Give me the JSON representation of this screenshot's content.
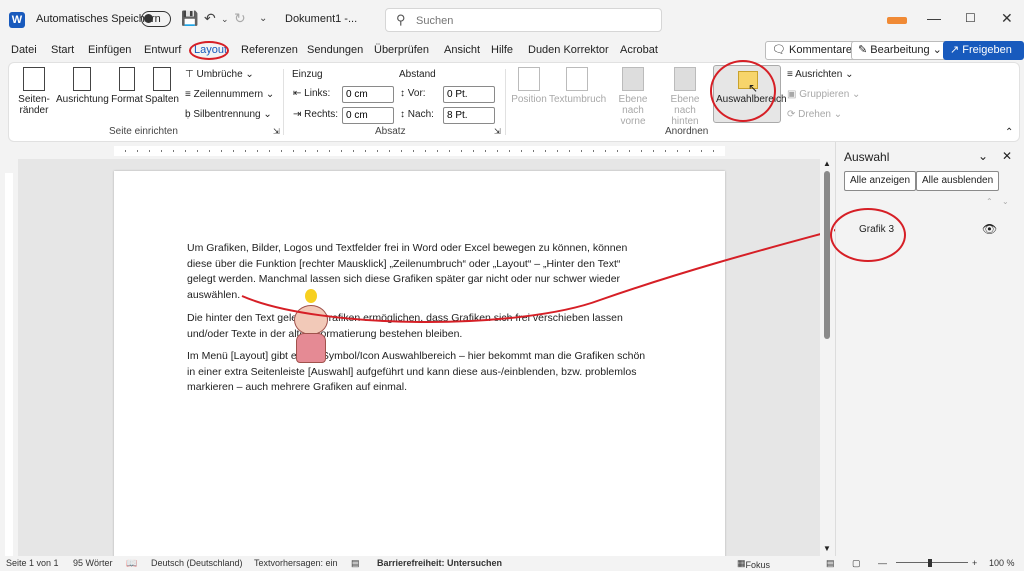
{
  "titlebar": {
    "autosave": "Automatisches Speichern",
    "doc_title": "Dokument1  -...",
    "search_placeholder": "Suchen"
  },
  "tabs": [
    "Datei",
    "Start",
    "Einfügen",
    "Entwurf",
    "Layout",
    "Referenzen",
    "Sendungen",
    "Überprüfen",
    "Ansicht",
    "Hilfe",
    "Duden Korrektor",
    "Acrobat"
  ],
  "ribbon_buttons": {
    "kommentare": "Kommentare",
    "bearbeitung": "Bearbeitung",
    "freigeben": "Freigeben"
  },
  "ribbon": {
    "seitenraender": "Seiten-\nränder",
    "ausrichtung": "Ausrichtung",
    "format": "Format",
    "spalten": "Spalten",
    "umbrueche": "Umbrüche",
    "zeilennummern": "Zeilennummern",
    "silbentrennung": "Silbentrennung",
    "group_seite": "Seite einrichten",
    "einzug": "Einzug",
    "abstand": "Abstand",
    "links": "Links:",
    "links_val": "0 cm",
    "rechts": "Rechts:",
    "rechts_val": "0 cm",
    "vor": "Vor:",
    "vor_val": "0 Pt.",
    "nach": "Nach:",
    "nach_val": "8 Pt.",
    "group_absatz": "Absatz",
    "position": "Position",
    "textumbruch": "Textumbruch",
    "ebene_vorne": "Ebene nach\nvorne",
    "ebene_hinten": "Ebene nach\nhinten",
    "auswahlbereich": "Auswahlbereich",
    "ausrichten": "Ausrichten",
    "gruppieren": "Gruppieren",
    "drehen": "Drehen",
    "group_anordnen": "Anordnen"
  },
  "document": {
    "p1": "Um Grafiken, Bilder, Logos und Textfelder frei in Word oder Excel bewegen zu können, können diese über die Funktion [rechter Mausklick] „Zeilenumbruch“ oder „Layout“ – „Hinter den Text“ gelegt werden. Manchmal lassen sich diese Grafiken später gar nicht oder nur schwer wieder auswählen.",
    "p2": "Die hinter den Text gelegten Grafiken ermöglichen, dass Grafiken sich frei verschieben lassen und/oder Texte in der alten Formatierung bestehen bleiben.",
    "p3": "Im Menü [Layout] gibt es ein Symbol/Icon Auswahlbereich – hier bekommt man die Grafiken schön in einer extra Seitenleiste [Auswahl] aufgeführt und kann diese aus-/einblenden, bzw. problemlos markieren – auch mehrere Grafiken auf einmal."
  },
  "pane": {
    "title": "Auswahl",
    "show_all": "Alle anzeigen",
    "hide_all": "Alle ausblenden",
    "item": "Grafik 3"
  },
  "status": {
    "page": "Seite 1 von 1",
    "words": "95 Wörter",
    "language": "Deutsch (Deutschland)",
    "predictions": "Textvorhersagen: ein",
    "accessibility": "Barrierefreiheit: Untersuchen",
    "focus": "Fokus",
    "zoom": "100 %"
  },
  "colors": {
    "accent": "#185abd",
    "annotation": "#d61f26"
  }
}
